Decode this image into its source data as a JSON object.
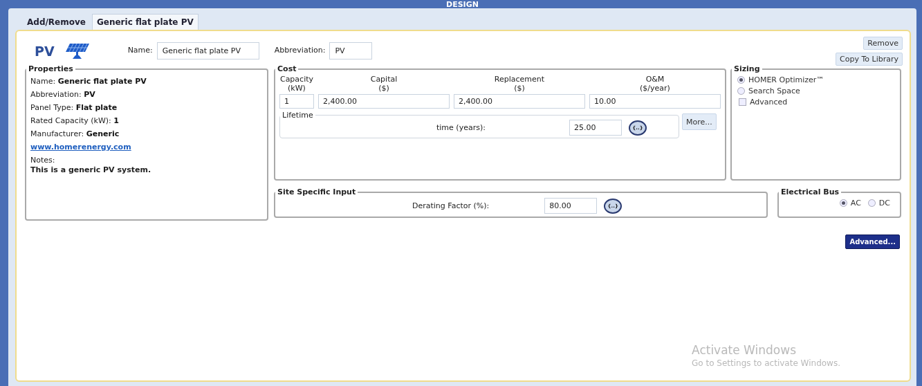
{
  "window": {
    "title": "DESIGN"
  },
  "tabs": [
    {
      "label": "Add/Remove",
      "selected": false
    },
    {
      "label": "Generic flat plate PV",
      "selected": true
    }
  ],
  "header": {
    "component": "PV",
    "name_label": "Name:",
    "name_value": "Generic flat plate PV",
    "abbreviation_label": "Abbreviation:",
    "abbreviation_value": "PV",
    "buttons": [
      "Remove",
      "Copy To Library"
    ]
  },
  "properties": {
    "title": "Properties",
    "rows": [
      {
        "label": "Name:",
        "value": "Generic flat plate PV"
      },
      {
        "label": "Abbreviation:",
        "value": "PV"
      },
      {
        "label": "Panel Type:",
        "value": "Flat plate"
      },
      {
        "label": "Rated Capacity (kW):",
        "value": "1"
      },
      {
        "label": "Manufacturer:",
        "value": "Generic"
      }
    ],
    "link": "www.homerenergy.com",
    "notes_label": "Notes:",
    "notes": "This is a generic PV system."
  },
  "cost": {
    "title": "Cost",
    "columns": [
      {
        "heading": "Capacity",
        "unit": "(kW)",
        "value": "1"
      },
      {
        "heading": "Capital",
        "unit": "($)",
        "value": "2,400.00"
      },
      {
        "heading": "Replacement",
        "unit": "($)",
        "value": "2,400.00"
      },
      {
        "heading": "O&M",
        "unit": "($/year)",
        "value": "10.00"
      }
    ],
    "lifetime": {
      "title": "Lifetime",
      "label": "time (years):",
      "value": "25.00",
      "sensitivity": "{..}"
    },
    "more_button": "More..."
  },
  "sizing": {
    "title": "Sizing",
    "options": [
      {
        "kind": "radio",
        "label": "HOMER Optimizer™",
        "selected": true
      },
      {
        "kind": "radio",
        "label": "Search Space",
        "selected": false
      },
      {
        "kind": "checkbox",
        "label": "Advanced",
        "selected": false
      }
    ]
  },
  "site_input": {
    "title": "Site Specific Input",
    "label": "Derating Factor (%):",
    "value": "80.00",
    "sensitivity": "{..}"
  },
  "electrical_bus": {
    "title": "Electrical Bus",
    "options": [
      {
        "label": "AC",
        "selected": true
      },
      {
        "label": "DC",
        "selected": false
      }
    ]
  },
  "advanced_button": "Advanced...",
  "os_notice": {
    "title": "Activate Windows",
    "text": "Go to Settings to activate Windows."
  }
}
